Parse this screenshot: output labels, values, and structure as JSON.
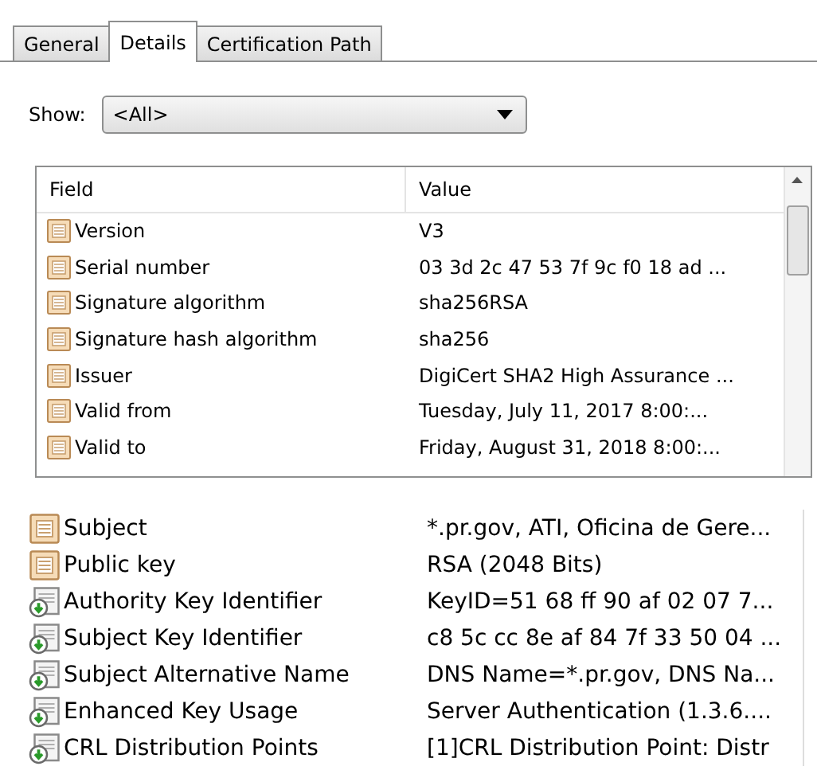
{
  "tabs": [
    {
      "label": "General",
      "selected": false
    },
    {
      "label": "Details",
      "selected": true
    },
    {
      "label": "Certification Path",
      "selected": false
    }
  ],
  "show": {
    "label": "Show:",
    "value": "<All>"
  },
  "table": {
    "columns": [
      "Field",
      "Value"
    ],
    "rows": [
      {
        "kind": "property",
        "field": "Version",
        "value": "V3"
      },
      {
        "kind": "property",
        "field": "Serial number",
        "value": "03 3d 2c 47 53 7f 9c f0 18 ad ..."
      },
      {
        "kind": "property",
        "field": "Signature algorithm",
        "value": "sha256RSA"
      },
      {
        "kind": "property",
        "field": "Signature hash algorithm",
        "value": "sha256"
      },
      {
        "kind": "property",
        "field": "Issuer",
        "value": "DigiCert SHA2 High Assurance ..."
      },
      {
        "kind": "property",
        "field": "Valid from",
        "value": "Tuesday, July 11, 2017 8:00:..."
      },
      {
        "kind": "property",
        "field": "Valid to",
        "value": "Friday, August 31, 2018 8:00:..."
      }
    ]
  },
  "table_2": {
    "rows": [
      {
        "kind": "property",
        "field": "Subject",
        "value": "*.pr.gov, ATI, Oficina de Gere..."
      },
      {
        "kind": "property",
        "field": "Public key",
        "value": "RSA (2048 Bits)"
      },
      {
        "kind": "extension",
        "field": "Authority Key Identifier",
        "value": "KeyID=51 68 ff 90 af 02 07 7..."
      },
      {
        "kind": "extension",
        "field": "Subject Key Identifier",
        "value": "c8 5c cc 8e af 84 7f 33 50 04 ..."
      },
      {
        "kind": "extension",
        "field": "Subject Alternative Name",
        "value": "DNS Name=*.pr.gov, DNS Na..."
      },
      {
        "kind": "extension",
        "field": "Enhanced Key Usage",
        "value": "Server Authentication (1.3.6...."
      },
      {
        "kind": "extension",
        "field": "CRL Distribution Points",
        "value": "[1]CRL Distribution Point: Distr"
      }
    ]
  }
}
